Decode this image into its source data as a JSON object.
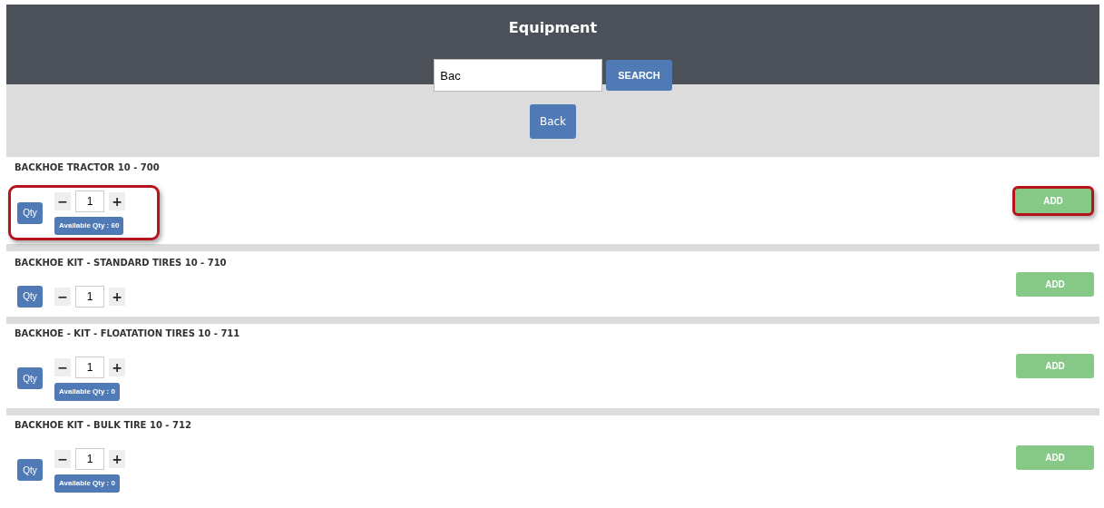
{
  "header": {
    "title": "Equipment"
  },
  "search": {
    "value": "Bac",
    "button": "SEARCH"
  },
  "back_button": "Back",
  "items": [
    {
      "name": "BACKHOE TRACTOR 10 - 700",
      "qty_label": "Qty",
      "minus": "−",
      "quantity": "1",
      "plus": "+",
      "available": "Available Qty : 60",
      "add": "ADD",
      "highlighted": true
    },
    {
      "name": "BACKHOE KIT - STANDARD TIRES 10 - 710",
      "qty_label": "Qty",
      "minus": "−",
      "quantity": "1",
      "plus": "+",
      "add": "ADD",
      "highlighted": false
    },
    {
      "name": "BACKHOE - KIT - FLOATATION TIRES 10 - 711",
      "qty_label": "Qty",
      "minus": "−",
      "quantity": "1",
      "plus": "+",
      "available": "Available Qty : 0",
      "add": "ADD",
      "highlighted": false
    },
    {
      "name": "BACKHOE KIT - BULK TIRE 10 - 712",
      "qty_label": "Qty",
      "minus": "−",
      "quantity": "1",
      "plus": "+",
      "available": "Available Qty : 0",
      "add": "ADD",
      "highlighted": false
    }
  ]
}
